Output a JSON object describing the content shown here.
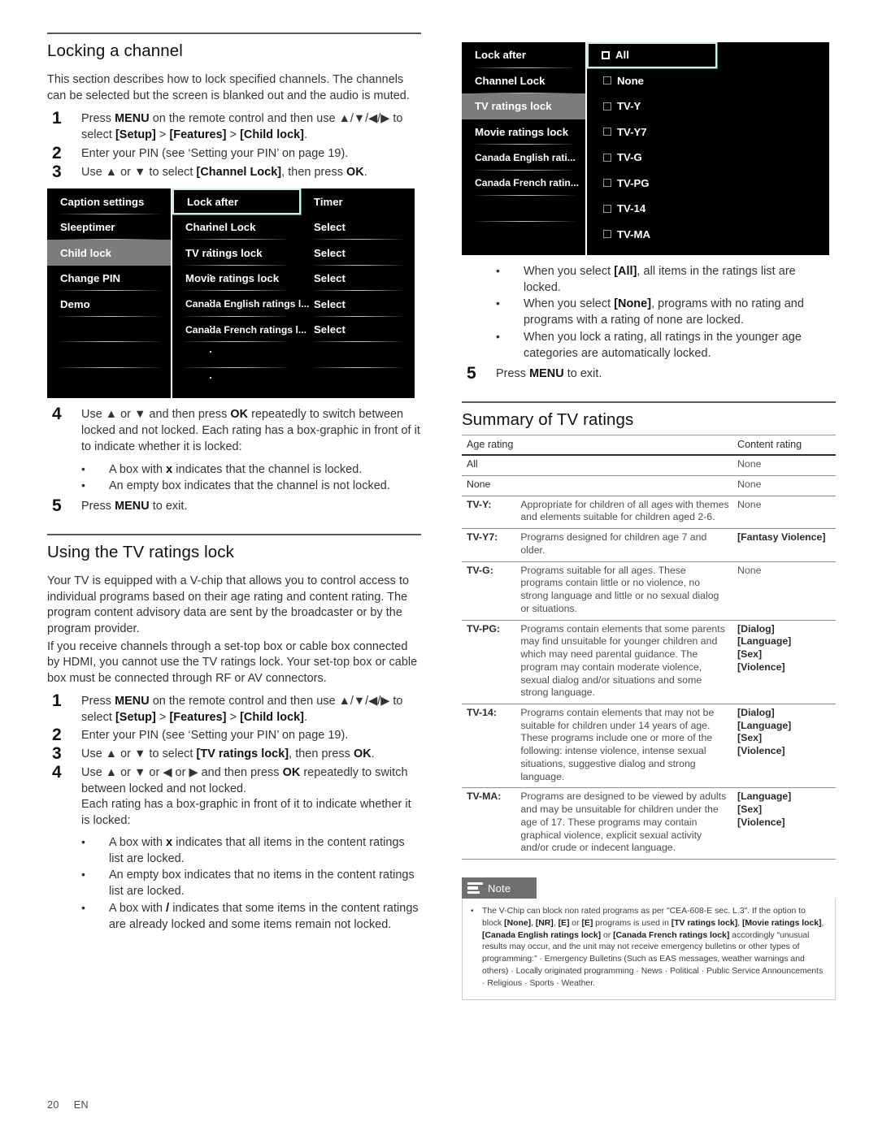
{
  "footer": {
    "page_number": "20",
    "language": "EN"
  },
  "left_column": {
    "section1": {
      "heading": "Locking a channel",
      "intro": "This section describes how to lock specified channels. The channels can be selected but the screen is blanked out and the audio is muted.",
      "steps": [
        {
          "num": "1",
          "text": "Press MENU on the remote control and then use ▲/▼/◀/▶ to select [Setup] > [Features] > [Child lock]."
        },
        {
          "num": "2",
          "text": "Enter your PIN (see ‘Setting your PIN’ on page 19)."
        },
        {
          "num": "3",
          "text": "Use ▲ or ▼ to select [Channel Lock], then press OK."
        }
      ],
      "steps_after": [
        {
          "num": "4",
          "text": "Use ▲ or ▼ and then press OK repeatedly to switch between locked and not locked. Each rating has a box-graphic in front of it to indicate whether it is locked:"
        }
      ],
      "bullets_after": [
        "A box with x indicates that the channel is locked.",
        "An empty box indicates that the channel is not locked."
      ],
      "final_step": {
        "num": "5",
        "text": "Press MENU to exit."
      }
    },
    "osd": {
      "left_items": [
        "Caption settings",
        "Sleeptimer",
        "Child lock",
        "Change PIN",
        "Demo"
      ],
      "selected_left": "Child lock",
      "middle_items": [
        "Lock after",
        "Channel Lock",
        "TV ratings lock",
        "Movie ratings lock",
        "Canada English ratings l...",
        "Canada French ratings l..."
      ],
      "highlighted_middle": "Lock after",
      "right_values": [
        "Timer",
        "Select",
        "Select",
        "Select",
        "Select",
        "Select"
      ]
    },
    "section2": {
      "heading": "Using the TV ratings lock",
      "para1": "Your TV is equipped with a V-chip that allows you to control access to individual programs based on their age rating and content rating. The program content advisory data are sent by the broadcaster or by the program provider.",
      "para2": "If you receive channels through a set-top box or cable box connected by HDMI, you cannot use the TV ratings lock. Your set-top box or cable box must be connected through RF or AV connectors.",
      "steps": [
        {
          "num": "1",
          "text": "Press MENU on the remote control and then use ▲/▼/◀/▶ to select [Setup] > [Features] > [Child lock]."
        },
        {
          "num": "2",
          "text": "Enter your PIN (see ‘Setting your PIN’ on page 19)."
        },
        {
          "num": "3",
          "text": "Use ▲ or ▼ to select [TV ratings lock], then press OK."
        },
        {
          "num": "4",
          "text": "Use ▲ or ▼ or ◀ or ▶ and then press OK repeatedly to switch between locked and not locked."
        }
      ],
      "step4_cont": "Each rating has a box-graphic in front of it to indicate whether it is locked:",
      "bullets": [
        "A box with x indicates that all items in the content ratings list are locked.",
        "An empty box indicates that no items in the content ratings list are locked.",
        "A box with / indicates that some items in the content ratings are already locked and some items remain not locked."
      ]
    }
  },
  "right_column": {
    "osd": {
      "left_items": [
        "Lock after",
        "Channel Lock",
        "TV ratings lock",
        "Movie ratings lock",
        "Canada English rati...",
        "Canada French ratin..."
      ],
      "selected_left": "TV ratings lock",
      "ratings": [
        "All",
        "None",
        "TV-Y",
        "TV-Y7",
        "TV-G",
        "TV-PG",
        "TV-14",
        "TV-MA"
      ],
      "highlighted_rating": "All"
    },
    "bullets": [
      "When you select [All], all items in the ratings list are locked.",
      "When you select [None], programs with no rating and programs with a rating of none are locked.",
      "When you lock a rating, all ratings in the younger age categories are automatically locked."
    ],
    "final_step": {
      "num": "5",
      "text": "Press MENU to exit."
    },
    "summary_heading": "Summary of TV ratings",
    "table": {
      "headers": [
        "Age rating",
        "Content rating"
      ],
      "rows": [
        {
          "age": "All",
          "age_bold": false,
          "desc": "",
          "content": [
            "None"
          ],
          "content_bold": false
        },
        {
          "age": "None",
          "age_bold": false,
          "desc": "",
          "content": [
            "None"
          ],
          "content_bold": false
        },
        {
          "age": "TV-Y:",
          "age_bold": true,
          "desc": "Appropriate for children of all ages with themes and elements suitable for children aged 2-6.",
          "content": [
            "None"
          ],
          "content_bold": false
        },
        {
          "age": "TV-Y7:",
          "age_bold": true,
          "desc": "Programs designed for children age 7 and older.",
          "content": [
            "[Fantasy Violence]"
          ],
          "content_bold": true
        },
        {
          "age": "TV-G:",
          "age_bold": true,
          "desc": "Programs suitable for all ages. These programs contain little or no violence, no strong language and little or no sexual dialog or situations.",
          "content": [
            "None"
          ],
          "content_bold": false
        },
        {
          "age": "TV-PG:",
          "age_bold": true,
          "desc": "Programs contain elements that some parents may find unsuitable for younger children and which may need parental guidance. The program may contain moderate violence, sexual dialog and/or situations and some strong language.",
          "content": [
            "[Dialog]",
            "[Language]",
            "[Sex]",
            "[Violence]"
          ],
          "content_bold": true
        },
        {
          "age": "TV-14:",
          "age_bold": true,
          "desc": "Programs contain elements that may not be suitable for children under 14 years of age. These programs include one or more of the following: intense violence, intense sexual situations, suggestive dialog and strong language.",
          "content": [
            "[Dialog]",
            "[Language]",
            "[Sex]",
            "[Violence]"
          ],
          "content_bold": true
        },
        {
          "age": "TV-MA:",
          "age_bold": true,
          "desc": "Programs are designed to be viewed by adults and may be unsuitable for children under the age of 17. These programs may contain graphical violence, explicit sexual activity and/or crude or indecent language.",
          "content": [
            "[Language]",
            "[Sex]",
            "[Violence]"
          ],
          "content_bold": true
        }
      ]
    },
    "note": {
      "label": "Note",
      "text": "The V-Chip can block non rated programs as per \"CEA-608-E sec. L.3\". If the option to block [None], [NR], [E] or [E] programs is used in [TV ratings lock], [Movie ratings lock], [Canada English ratings lock] or [Canada French ratings lock] accordingly “unusual results may occur, and the unit may not receive emergency bulletins or other types of programming:” · Emergency Bulletins (Such as EAS messages, weather warnings and others) · Locally originated programming · News · Political · Public Service Announcements · Religious · Sports · Weather."
    }
  }
}
